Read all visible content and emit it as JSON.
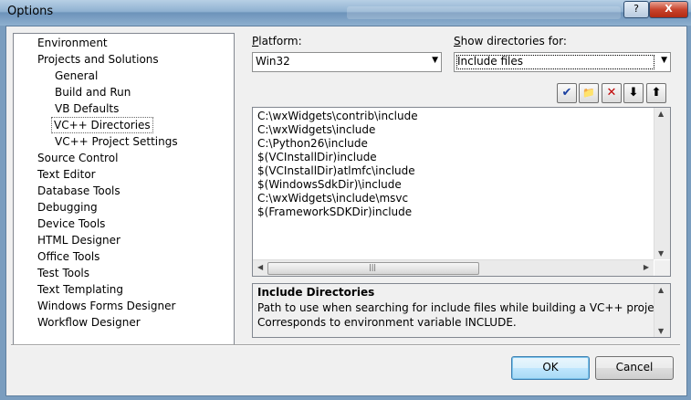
{
  "window": {
    "title": "Options"
  },
  "titlebar_buttons": {
    "help": "?",
    "close": "X"
  },
  "tree": {
    "items": [
      {
        "label": "Environment"
      },
      {
        "label": "Projects and Solutions"
      },
      {
        "label": "General"
      },
      {
        "label": "Build and Run"
      },
      {
        "label": "VB Defaults"
      },
      {
        "label": "VC++ Directories",
        "selected": true
      },
      {
        "label": "VC++ Project Settings"
      },
      {
        "label": "Source Control"
      },
      {
        "label": "Text Editor"
      },
      {
        "label": "Database Tools"
      },
      {
        "label": "Debugging"
      },
      {
        "label": "Device Tools"
      },
      {
        "label": "HTML Designer"
      },
      {
        "label": "Office Tools"
      },
      {
        "label": "Test Tools"
      },
      {
        "label": "Text Templating"
      },
      {
        "label": "Windows Forms Designer"
      },
      {
        "label": "Workflow Designer"
      }
    ]
  },
  "platform": {
    "accel": "P",
    "label_rest": "latform:",
    "value": "Win32"
  },
  "show_dirs": {
    "accel": "S",
    "label_rest": "how directories for:",
    "value": "Include files"
  },
  "toolbar": {
    "new_line_icon": "✔",
    "new_folder_icon": "📁",
    "delete_icon": "✕",
    "move_down_icon": "⬇",
    "move_up_icon": "⬆"
  },
  "directories": [
    "C:\\wxWidgets\\contrib\\include",
    "C:\\wxWidgets\\include",
    "C:\\Python26\\include",
    "$(VCInstallDir)include",
    "$(VCInstallDir)atlmfc\\include",
    "$(WindowsSdkDir)\\include",
    "C:\\wxWidgets\\include\\msvc",
    "$(FrameworkSDKDir)include"
  ],
  "description": {
    "title": "Include Directories",
    "line1": "Path to use when searching for include files while building a VC++ project.",
    "line2": "Corresponds to environment variable INCLUDE."
  },
  "buttons": {
    "ok": "OK",
    "cancel": "Cancel"
  },
  "colors": {
    "titlebar": "#8fb1d1",
    "dialog_bg": "#f0f0f0",
    "default_button": "#bee6fd",
    "close_button": "#c8442d"
  }
}
